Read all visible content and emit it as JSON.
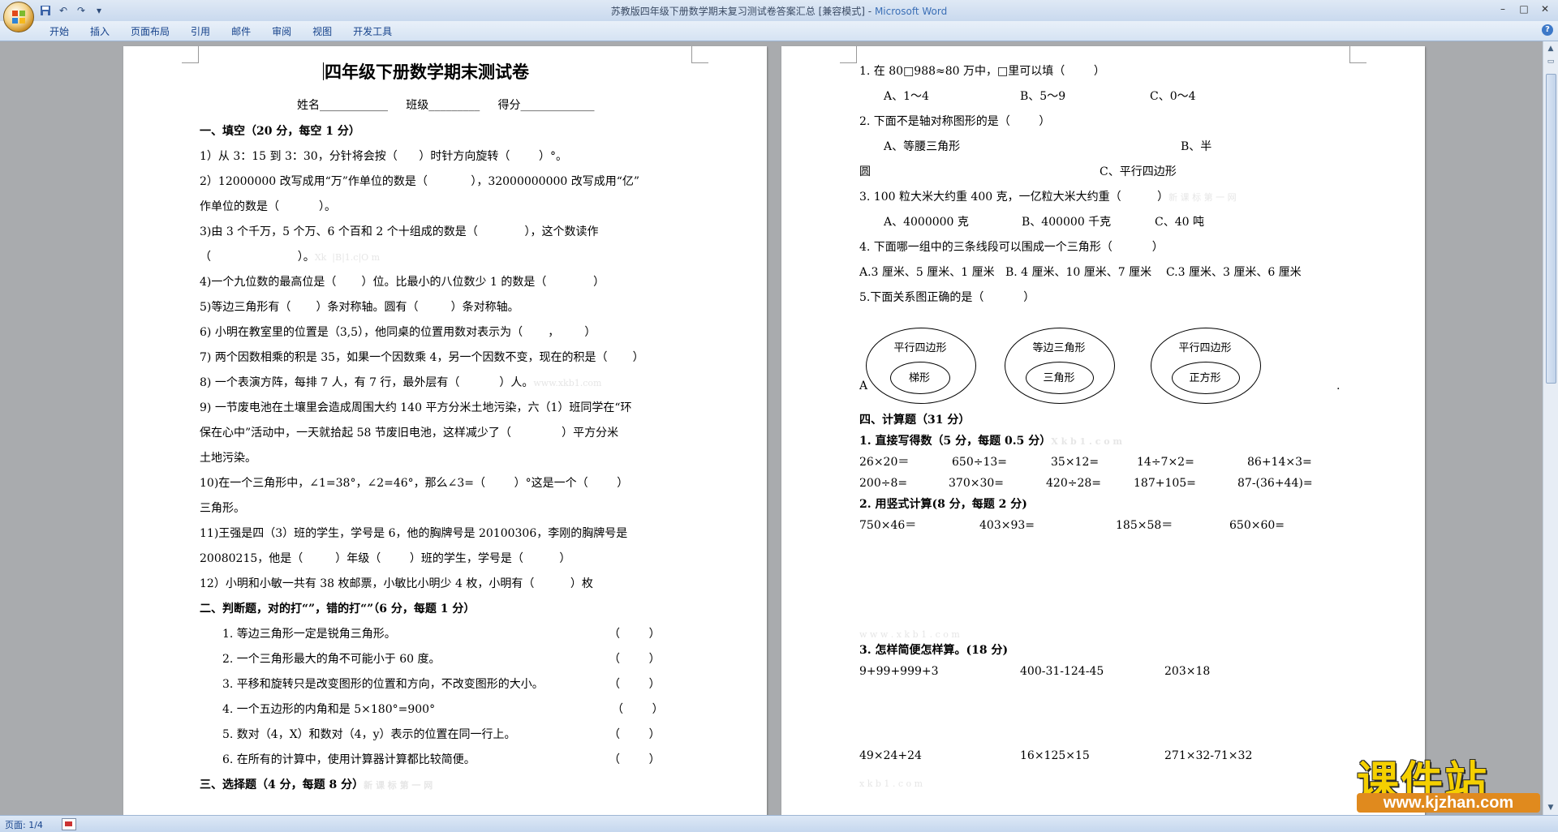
{
  "app": {
    "window_title": "苏教版四年级下册数学期末复习测试卷答案汇总 [兼容模式]",
    "title_separator": " - ",
    "app_name": "Microsoft Word"
  },
  "qat": {
    "save": "save-icon",
    "undo": "undo-icon",
    "redo": "redo-icon",
    "customize": "▾"
  },
  "window_controls": {
    "minimize": "–",
    "maximize": "□",
    "close": "✕"
  },
  "ribbon": {
    "tabs": [
      "开始",
      "插入",
      "页面布局",
      "引用",
      "邮件",
      "审阅",
      "视图",
      "开发工具"
    ],
    "help": "?"
  },
  "page1": {
    "title": "四年级下册数学期末测试卷",
    "lines": [
      "姓名____________     班级_________     得分_____________",
      "一、填空（20 分，每空 1 分）",
      "1）从 3：15 到 3：30，分针将会按（      ）时针方向旋转（        ）°。",
      "2）12000000 改写成用“万”作单位的数是（            ），32000000000 改写成用“亿”",
      "作单位的数是（           ）。",
      "3)由 3 个千万，5 个万、6 个百和 2 个十组成的数是（             ），这个数读作",
      "（                        ）。",
      "4)一个九位数的最高位是（       ）位。比最小的八位数少 1 的数是（             ）",
      "5)等边三角形有（       ）条对称轴。圆有（         ）条对称轴。",
      "6) 小明在教室里的位置是（3,5），他同桌的位置用数对表示为（       ，       ）",
      "7) 两个因数相乘的积是 35，如果一个因数乘 4，另一个因数不变，现在的积是（       ）",
      "8) 一个表演方阵，每排 7 人，有 7 行，最外层有（           ）人。",
      "9) 一节废电池在土壤里会造成周围大约 140 平方分米土地污染，六（1）班同学在“环",
      "保在心中”活动中，一天就拾起 58 节废旧电池，这样减少了（              ）平方分米",
      "土地污染。",
      "10)在一个三角形中，∠1=38°，∠2=46°，那么∠3=（        ）°这是一个（        ）",
      "三角形。",
      "11)王强是四（3）班的学生，学号是 6，他的胸牌号是 20100306，李刚的胸牌号是",
      "20080215，他是（         ）年级（        ）班的学生，学号是（          ）",
      "12）小明和小敏一共有 38 枚邮票，小敏比小明少 4 枚，小明有（          ）枚",
      "二、判断题，对的打“”，错的打“”（6 分，每题 1 分）",
      "1. 等边三角形一定是锐角三角形。",
      "2. 一个三角形最大的角不可能小于 60 度。",
      "3. 平移和旋转只是改变图形的位置和方向，不改变图形的大小。",
      "4. 一个五边形的内角和是 5×180°=900°",
      "5. 数对（4，X）和数对（4，y）表示的位置在同一行上。",
      "6. 在所有的计算中，使用计算器计算都比较简便。",
      "三、选择题（4 分，每题 8 分）"
    ],
    "brackets": [
      "（        ）",
      "（        ）",
      "（        ）",
      "（        ）",
      "（        ）",
      "（        ）"
    ],
    "faint_marks": [
      "Xk  |B|1.c|O m",
      "www.xkb1.com",
      "新 课 标 第 一 网"
    ]
  },
  "page2": {
    "lines": [
      "1. 在 80□988≈80 万中，□里可以填（        ）",
      "A、1～4",
      "B、5～9",
      "C、0～4",
      "2. 下面不是轴对称图形的是（        ）",
      "A、等腰三角形",
      "B、半",
      "圆",
      "C、平行四边形",
      "3. 100 粒大米大约重 400 克，一亿粒大米大约重（          ）",
      "A、4000000 克",
      "B、400000 千克",
      "C、40 吨",
      "4. 下面哪一组中的三条线段可以围成一个三角形（           ）",
      "A.3 厘米、5 厘米、1 厘米   B. 4 厘米、10 厘米、7 厘米    C.3 厘米、3 厘米、6 厘米",
      "5.下面关系图正确的是（           ）",
      "A",
      ".",
      "四、计算题（31 分）",
      "1. 直接写得数（5 分，每题 0.5 分）",
      "2. 用竖式计算(8 分，每题 2 分)",
      "3. 怎样简便怎样算。(18 分)"
    ],
    "venn": [
      {
        "outer": "平行四边形",
        "inner": "梯形"
      },
      {
        "outer": "等边三角形",
        "inner": "三角形"
      },
      {
        "outer": "平行四边形",
        "inner": "正方形"
      }
    ],
    "direct_row1": [
      "26×20＝",
      "650÷13=",
      "35×12=",
      "14÷7×2=",
      "86+14×3="
    ],
    "direct_row2": [
      "200÷8=",
      "370×30=",
      "420÷28=",
      "187+105=",
      "87-(36+44)="
    ],
    "vertical": [
      "750×46＝",
      "403×93=",
      "185×58＝",
      "650×60="
    ],
    "simple_row1": [
      "9+99+999+3",
      "400-31-124-45",
      "203×18"
    ],
    "simple_row2": [
      "49×24+24",
      "16×125×15",
      "271×32-71×32"
    ],
    "faint_marks": [
      "新 课 标 第 一 网",
      "X k b 1 . c o m",
      "w w w . x k b 1 . c o m",
      "x k b 1 . c o m"
    ]
  },
  "status": {
    "page": "页面: 1/4"
  },
  "watermark": {
    "logo": "课件站",
    "url": "www.kjzhan.com"
  }
}
